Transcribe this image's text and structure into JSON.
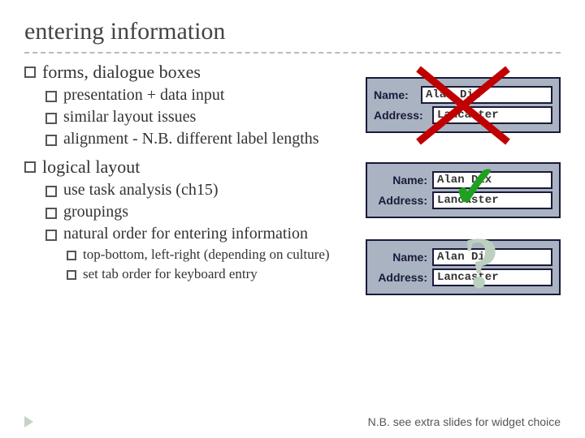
{
  "title": "entering information",
  "bullets": {
    "b1": "forms, dialogue boxes",
    "b1a": "presentation + data input",
    "b1b": "similar layout issues",
    "b1c": "alignment - N.B. different label lengths",
    "b2": "logical layout",
    "b2a": "use task analysis (ch15)",
    "b2b": "groupings",
    "b2c": "natural order for entering information",
    "b2c1": "top-bottom, left-right (depending on culture)",
    "b2c2": "set tab order for keyboard entry"
  },
  "form": {
    "name_label": "Name:",
    "address_label": "Address:",
    "name_value": "Alan Dix",
    "address_value": "Lancaster"
  },
  "marks": {
    "tick": "✓",
    "question": "?"
  },
  "footer": "N.B. see extra slides for widget choice"
}
